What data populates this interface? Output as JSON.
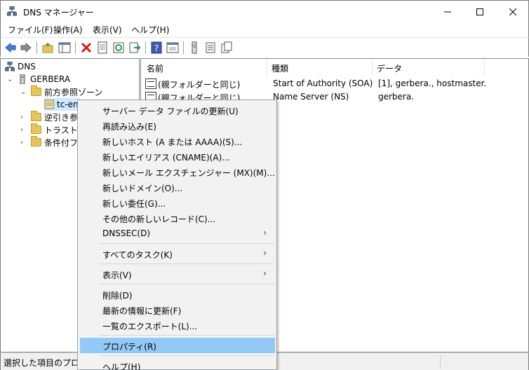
{
  "window": {
    "title": "DNS マネージャー",
    "minimize_glyph": "—",
    "maximize_glyph": "☐",
    "close_glyph": "✕"
  },
  "menubar": {
    "items": [
      "ファイル(F)",
      "操作(A)",
      "表示(V)",
      "ヘルプ(H)"
    ]
  },
  "toolbar": {
    "icons": [
      "back-icon",
      "forward-icon",
      "up-folder-icon",
      "show-tree-icon",
      "delete-icon",
      "properties-icon",
      "refresh-icon",
      "export-icon",
      "help-icon",
      "console-icon",
      "server-icon",
      "list-icon",
      "records-icon"
    ]
  },
  "tree": {
    "root": "DNS",
    "server": "GERBERA",
    "forward_zones": "前方参照ゾーン",
    "zone_selected": "tc-en",
    "reverse_zones": "逆引き参",
    "trust_points": "トラスト ポ",
    "conditional": "条件付フ"
  },
  "list": {
    "columns": [
      "名前",
      "種類",
      "データ"
    ],
    "rows": [
      {
        "name": "(親フォルダーと同じ)",
        "type": "Start of Authority (SOA)",
        "data": "[1], gerbera., hostmaster."
      },
      {
        "name": "(親フォルダーと同じ)",
        "type": "Name Server (NS)",
        "data": "gerbera."
      }
    ]
  },
  "context_menu": {
    "items": [
      {
        "label": "サーバー データ ファイルの更新(U)"
      },
      {
        "label": "再読み込み(E)"
      },
      {
        "label": "新しいホスト (A または AAAA)(S)..."
      },
      {
        "label": "新しいエイリアス (CNAME)(A)..."
      },
      {
        "label": "新しいメール エクスチェンジャー (MX)(M)..."
      },
      {
        "label": "新しいドメイン(O)..."
      },
      {
        "label": "新しい委任(G)..."
      },
      {
        "label": "その他の新しいレコード(C)..."
      },
      {
        "label": "DNSSEC(D)",
        "submenu": true
      },
      {
        "label": "すべてのタスク(K)",
        "submenu": true
      },
      {
        "label": "表示(V)",
        "submenu": true
      },
      {
        "label": "削除(D)"
      },
      {
        "label": "最新の情報に更新(F)"
      },
      {
        "label": "一覧のエクスポート(L)..."
      },
      {
        "label": "プロパティ(R)",
        "highlighted": true
      },
      {
        "label": "ヘルプ(H)"
      }
    ],
    "submenu_arrow": "›"
  },
  "statusbar": {
    "text": "選択した項目のプロパテ"
  },
  "colors": {
    "highlight": "#91c9f7",
    "selection": "#cce8ff"
  }
}
